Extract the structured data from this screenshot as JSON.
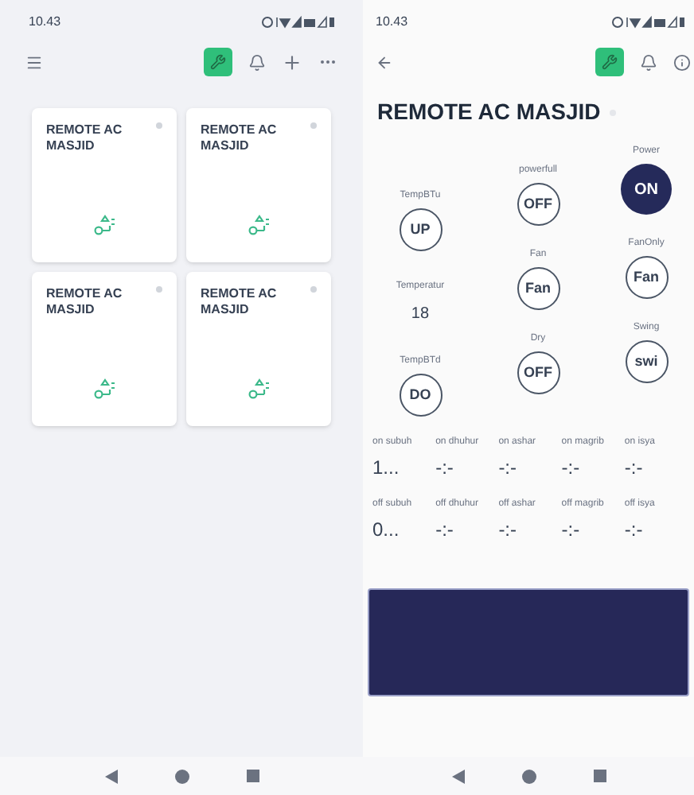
{
  "left": {
    "status_bar": {
      "time": "10.43"
    },
    "devices": [
      {
        "name": "REMOTE AC MASJID"
      },
      {
        "name": "REMOTE AC MASJID"
      },
      {
        "name": "REMOTE AC MASJID"
      },
      {
        "name": "REMOTE AC MASJID"
      }
    ]
  },
  "right": {
    "status_bar": {
      "time": "10.43"
    },
    "title": "REMOTE AC MASJID",
    "control_columns": [
      [
        {
          "kind": "button",
          "label": "TempBTu",
          "value": "UP",
          "active": false
        },
        {
          "kind": "reading",
          "label": "Temperatur",
          "value": "18"
        },
        {
          "kind": "button",
          "label": "TempBTd",
          "value": "DO",
          "active": false
        }
      ],
      [
        {
          "kind": "button",
          "label": "powerfull",
          "value": "OFF",
          "active": false
        },
        {
          "kind": "button",
          "label": "Fan",
          "value": "Fan",
          "active": false
        },
        {
          "kind": "button",
          "label": "Dry",
          "value": "OFF",
          "active": false
        }
      ],
      [
        {
          "kind": "button",
          "label": "Power",
          "value": "ON",
          "active": true
        },
        {
          "kind": "button",
          "label": "FanOnly",
          "value": "Fan",
          "active": false
        },
        {
          "kind": "button",
          "label": "Swing",
          "value": "swi",
          "active": false
        }
      ]
    ],
    "schedule_rows": [
      [
        {
          "label": "on subuh",
          "value": "1..."
        },
        {
          "label": "on dhuhur",
          "value": "-:-"
        },
        {
          "label": "on ashar",
          "value": "-:-"
        },
        {
          "label": "on magrib",
          "value": "-:-"
        },
        {
          "label": "on isya",
          "value": "-:-"
        }
      ],
      [
        {
          "label": "off subuh",
          "value": "0..."
        },
        {
          "label": "off dhuhur",
          "value": "-:-"
        },
        {
          "label": "off ashar",
          "value": "-:-"
        },
        {
          "label": "off magrib",
          "value": "-:-"
        },
        {
          "label": "off isya",
          "value": "-:-"
        }
      ]
    ]
  }
}
